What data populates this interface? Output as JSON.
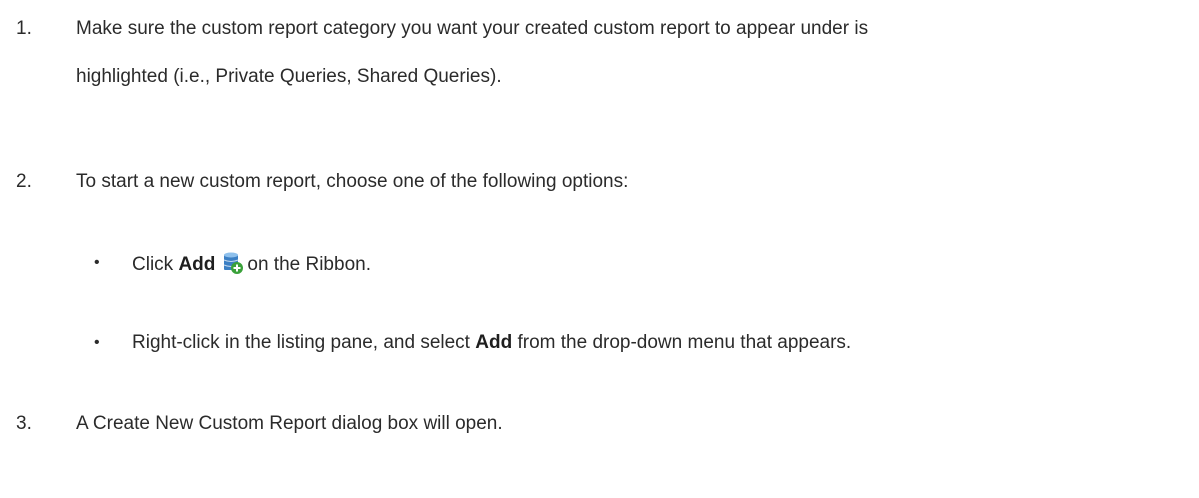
{
  "steps": [
    {
      "number": "1.",
      "line1": "Make sure the custom report category you want your created custom report to appear under is",
      "line2": "highlighted (i.e., Private Queries, Shared Queries)."
    },
    {
      "number": "2.",
      "text": "To start a new custom report, choose one of the following options:",
      "options": [
        {
          "bullet": "•",
          "before": "Click",
          "bold": "Add",
          "icon": "database-add-icon",
          "after": "on the Ribbon."
        },
        {
          "bullet": "•",
          "before": "Right-click in the listing pane, and select",
          "bold": "Add",
          "after": "from the drop-down menu that appears."
        }
      ]
    },
    {
      "number": "3.",
      "text": "A Create New Custom Report dialog box will open."
    }
  ],
  "colors": {
    "text": "#2b2b2b",
    "icon_db": "#3b7fc4",
    "icon_plus": "#3aa13a"
  }
}
